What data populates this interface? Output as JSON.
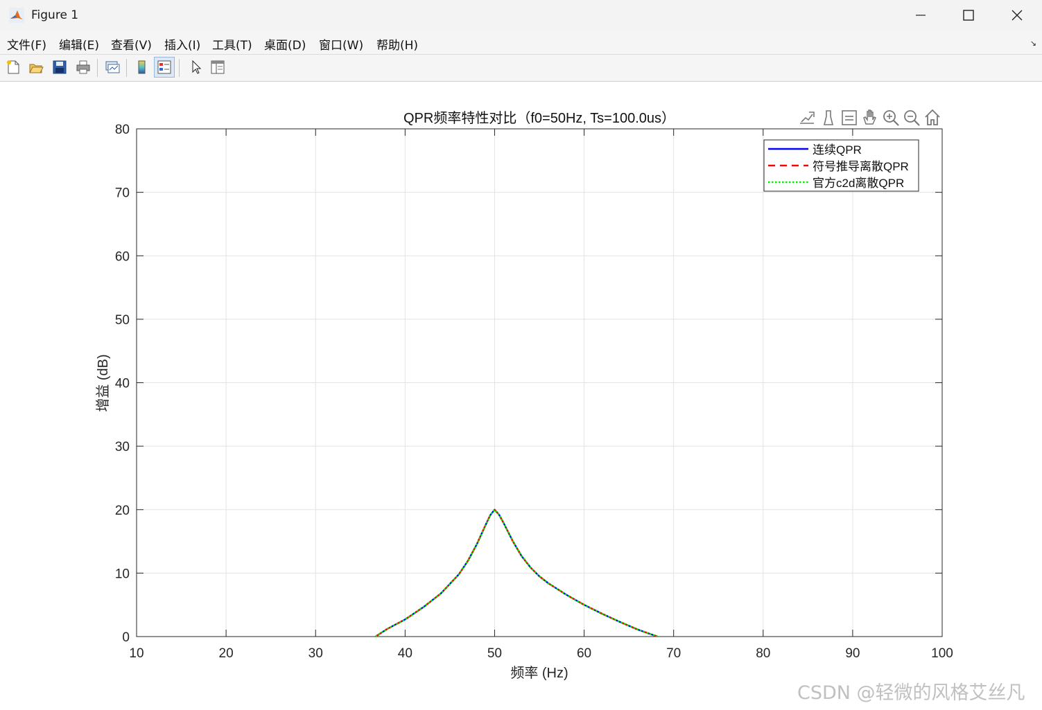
{
  "window": {
    "title": "Figure 1"
  },
  "menu": [
    "文件(F)",
    "编辑(E)",
    "查看(V)",
    "插入(I)",
    "工具(T)",
    "桌面(D)",
    "窗口(W)",
    "帮助(H)"
  ],
  "toolbar": {
    "buttons": [
      "new-figure-icon",
      "open-file-icon",
      "save-icon",
      "print-icon",
      "link-plot-icon",
      "colorbar-icon",
      "legend-icon",
      "edit-plot-arrow-icon",
      "property-inspector-icon"
    ]
  },
  "axes_toolbar": [
    "export-icon",
    "brush-icon",
    "data-tips-icon",
    "pan-hand-icon",
    "zoom-in-icon",
    "zoom-out-icon",
    "home-icon"
  ],
  "watermark": "CSDN @轻微的风格艾丝凡",
  "chart_data": {
    "type": "line",
    "title": "QPR频率特性对比（f0=50Hz, Ts=100.0us）",
    "xlabel": "频率 (Hz)",
    "ylabel": "增益 (dB)",
    "xlim": [
      10,
      100
    ],
    "ylim": [
      0,
      80
    ],
    "xticks": [
      10,
      20,
      30,
      40,
      50,
      60,
      70,
      80,
      90,
      100
    ],
    "yticks": [
      0,
      10,
      20,
      30,
      40,
      50,
      60,
      70,
      80
    ],
    "grid": true,
    "legend_position": "top-right",
    "x": [
      36.7,
      38,
      40,
      42,
      44,
      46,
      47,
      48,
      49,
      49.5,
      50,
      50.5,
      51,
      52,
      53,
      54,
      55,
      56,
      58,
      60,
      62,
      64,
      66,
      68.2
    ],
    "series": [
      {
        "name": "连续QPR",
        "color": "#0000ff",
        "style": "solid",
        "values": [
          0.0,
          1.2,
          2.7,
          4.6,
          6.8,
          9.8,
          11.9,
          14.5,
          17.6,
          19.1,
          20.0,
          19.2,
          17.9,
          15.1,
          12.7,
          10.9,
          9.5,
          8.4,
          6.6,
          5.0,
          3.6,
          2.3,
          1.1,
          0.0
        ]
      },
      {
        "name": "符号推导离散QPR",
        "color": "#ff0000",
        "style": "dashed",
        "values": [
          0.0,
          1.2,
          2.7,
          4.6,
          6.8,
          9.8,
          11.9,
          14.5,
          17.6,
          19.1,
          20.0,
          19.2,
          17.9,
          15.1,
          12.7,
          10.9,
          9.5,
          8.4,
          6.6,
          5.0,
          3.6,
          2.3,
          1.1,
          0.0
        ]
      },
      {
        "name": "官方c2d离散QPR",
        "color": "#00ee00",
        "style": "dotted",
        "values": [
          0.0,
          1.2,
          2.7,
          4.6,
          6.8,
          9.8,
          11.9,
          14.5,
          17.6,
          19.1,
          20.0,
          19.2,
          17.9,
          15.1,
          12.7,
          10.9,
          9.5,
          8.4,
          6.6,
          5.0,
          3.6,
          2.3,
          1.1,
          0.0
        ]
      }
    ]
  }
}
